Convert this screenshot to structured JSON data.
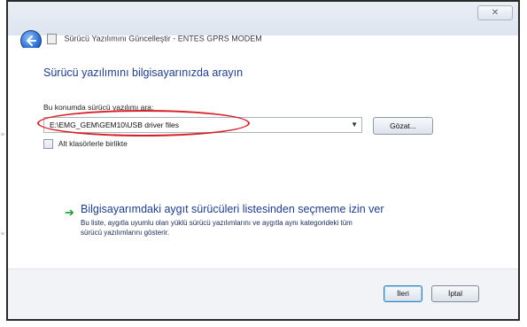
{
  "window": {
    "title": "Sürücü Yazılımını Güncelleştir - ENTES GPRS MODEM",
    "close_glyph": "✕"
  },
  "page": {
    "heading": "Sürücü yazılımını bilgisayarınızda arayın",
    "location_label": "Bu konumda sürücü yazılımı ara:",
    "path_value": "E:\\EMG_GEM\\GEM10\\USB driver files",
    "browse_label": "Gözat...",
    "include_subfolders_label": "Alt klasörlerle birlikte",
    "pick_option_title": "Bilgisayarımdaki aygıt sürücüleri listesinden seçmeme izin ver",
    "pick_option_desc_1": "Bu liste, aygıtla uyumlu olan yüklü sürücü yazılımlarını ve aygıtla aynı kategorideki tüm",
    "pick_option_desc_2": "sürücü yazılımlarını gösterir."
  },
  "footer": {
    "next_label": "İleri",
    "cancel_label": "İptal"
  },
  "icons": {
    "back": "back-arrow-icon",
    "title": "device-icon",
    "link_arrow": "green-arrow-icon"
  },
  "colors": {
    "heading_blue": "#1f3e86",
    "highlight_red": "#d72027",
    "link_green": "#1d9a2f"
  }
}
